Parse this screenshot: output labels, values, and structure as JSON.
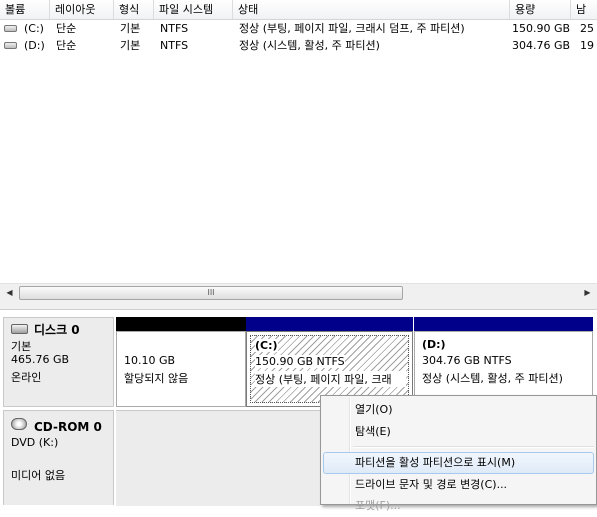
{
  "columns": [
    "볼륨",
    "레이아웃",
    "형식",
    "파일 시스템",
    "상태",
    "용량",
    "남"
  ],
  "volumes": [
    {
      "name": "(C:)",
      "layout": "단순",
      "type": "기본",
      "fs": "NTFS",
      "status": "정상 (부팅, 페이지 파일, 크래시 덤프, 주 파티션)",
      "capacity": "150.90 GB",
      "free": "25"
    },
    {
      "name": "(D:)",
      "layout": "단순",
      "type": "기본",
      "fs": "NTFS",
      "status": "정상 (시스템, 활성, 주 파티션)",
      "capacity": "304.76 GB",
      "free": "19"
    }
  ],
  "scrollbar": {
    "left_arrow": "◀",
    "right_arrow": "▶",
    "thumb_grip": "III"
  },
  "disks": [
    {
      "title": "디스크 0",
      "kind": "기본",
      "size": "465.76 GB",
      "state": "온라인"
    },
    {
      "title": "CD-ROM 0",
      "kind": "DVD (K:)",
      "state": "미디어 없음"
    }
  ],
  "partitions": [
    {
      "name": "",
      "size": "10.10 GB",
      "status": "할당되지 않음",
      "bar_color": "#000000"
    },
    {
      "name": "(C:)",
      "size": "150.90 GB NTFS",
      "status": "정상 (부팅, 페이지 파일, 크래",
      "bar_color": "#00008a"
    },
    {
      "name": "(D:)",
      "size": "304.76 GB NTFS",
      "status": "정상 (시스템, 활성, 주 파티션)",
      "bar_color": "#00008a"
    }
  ],
  "context_menu": {
    "items": [
      "열기(O)",
      "탐색(E)",
      "파티션을 활성 파티션으로 표시(M)",
      "드라이브 문자 및 경로 변경(C)...",
      "포맷(F)..."
    ],
    "highlighted_index": 2,
    "disabled_index": 4
  }
}
